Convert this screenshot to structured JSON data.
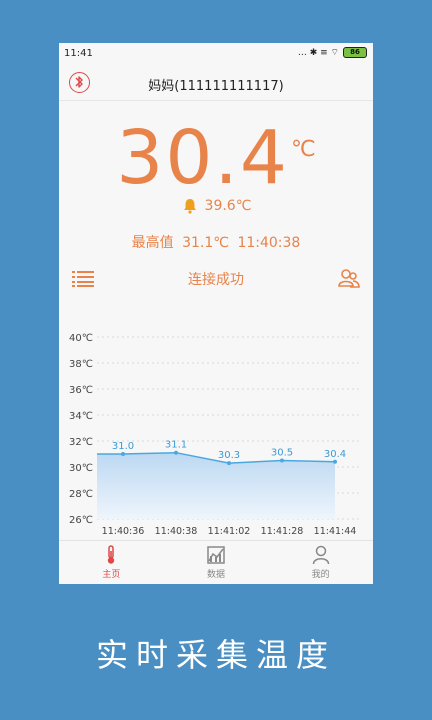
{
  "status": {
    "time": "11:41",
    "icons": "… ✱ ≡ ⌔",
    "battery": "86"
  },
  "header": {
    "title": "妈妈(111111111117)",
    "bluetooth_icon": "bluetooth-icon"
  },
  "reading": {
    "value": "30.4",
    "unit": "℃"
  },
  "alarm": {
    "value": "39.6℃",
    "icon": "bell-icon"
  },
  "max": {
    "label": "最高值",
    "value": "31.1℃",
    "time": "11:40:38"
  },
  "connection": {
    "status": "连接成功",
    "list_icon": "list-icon",
    "user_icon": "user-switch-icon"
  },
  "chart_data": {
    "type": "area",
    "x": [
      "11:40:36",
      "11:40:38",
      "11:41:02",
      "11:41:28",
      "11:41:44"
    ],
    "series": [
      {
        "values": [
          31.0,
          31.1,
          30.3,
          30.5,
          30.4
        ]
      }
    ],
    "y_ticks": [
      "40℃",
      "38℃",
      "36℃",
      "34℃",
      "32℃",
      "30℃",
      "28℃",
      "26℃"
    ],
    "ylim": [
      26,
      40
    ],
    "grid": true,
    "colors": {
      "line": "#4aa8e0",
      "fill": "#cfe3f6",
      "label": "#3b9ad6"
    }
  },
  "tabs": [
    {
      "label": "主页",
      "icon": "thermometer-icon",
      "active": true
    },
    {
      "label": "数据",
      "icon": "chart-icon",
      "active": false
    },
    {
      "label": "我的",
      "icon": "profile-icon",
      "active": false
    }
  ],
  "slogan": "实时采集温度",
  "colors": {
    "accent": "#e8834a",
    "background": "#4a8fc4",
    "active_tab": "#e04848"
  }
}
